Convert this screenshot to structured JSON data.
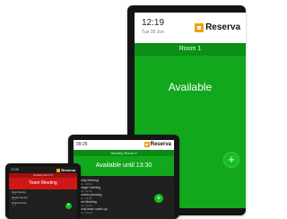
{
  "brand": {
    "name": "Reserva",
    "mark_color": "#f2a100"
  },
  "large_device": {
    "time": "12:19",
    "date": "Tue 20 Jun",
    "room": "Room 1",
    "status": "Available",
    "status_color": "#12a81d",
    "add_icon": "+"
  },
  "medium_device": {
    "time": "09:25",
    "room": "Hendey Room 3",
    "status": "Available until 13:30",
    "status_color": "#12a81d",
    "add_icon": "+",
    "meetings": [
      {
        "title": "Weekly Meeting",
        "sub": "09:30 - 10:00"
      },
      {
        "title": "Manager meeting",
        "sub": "10:30 - 11:00"
      },
      {
        "title": "Business planning",
        "sub": "11:00 - 12:00"
      },
      {
        "title": "Board Meeting",
        "sub": "13:30 - 14:30"
      },
      {
        "title": "Weekly team catch-up",
        "sub": "15:00 - 16:00"
      }
    ]
  },
  "small_device": {
    "time": "12:05",
    "room": "Hendey Room 2",
    "status": "Team Meeting",
    "status_color": "#d01616",
    "add_icon": "+",
    "meetings": [
      {
        "title": "Team Meeting",
        "sub": "12:00"
      },
      {
        "title": "Weekly Meeting",
        "sub": "13:00"
      },
      {
        "title": "Project Review",
        "sub": "14:00"
      }
    ]
  }
}
